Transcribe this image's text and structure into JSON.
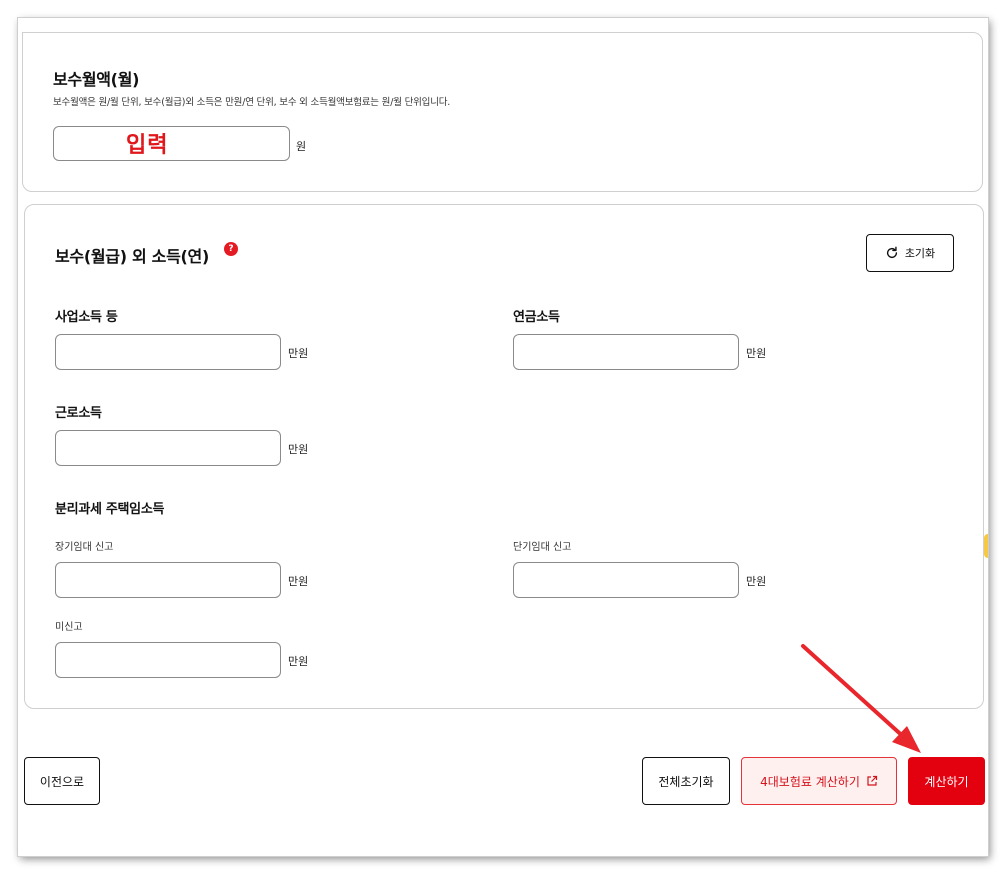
{
  "salary_section": {
    "title": "보수월액(월)",
    "description": "보수월액은 원/월 단위, 보수(월급)외 소득은 만원/연 단위, 보수 외 소득월액보험료는 원/월 단위입니다.",
    "input_value": "",
    "overlay_text": "입력",
    "unit": "원"
  },
  "other_income_section": {
    "title": "보수(월급) 외 소득(연)",
    "help_badge": "?",
    "reset_label": "초기화",
    "fields": {
      "business": {
        "label": "사업소득 등",
        "value": "",
        "unit": "만원"
      },
      "pension": {
        "label": "연금소득",
        "value": "",
        "unit": "만원"
      },
      "earned": {
        "label": "근로소득",
        "value": "",
        "unit": "만원"
      }
    },
    "rental": {
      "label": "분리과세 주택임소득",
      "long_term": {
        "label": "장기임대 신고",
        "value": "",
        "unit": "만원"
      },
      "short_term": {
        "label": "단기임대 신고",
        "value": "",
        "unit": "만원"
      },
      "unreported": {
        "label": "미신고",
        "value": "",
        "unit": "만원"
      }
    }
  },
  "footer": {
    "prev_label": "이전으로",
    "reset_all_label": "전체초기화",
    "four_insurance_label": "4대보험료 계산하기",
    "calculate_label": "계산하기"
  },
  "colors": {
    "accent_red": "#e3000f",
    "annotation_red": "#e0171b",
    "border": "#cfcfcf"
  },
  "icons": {
    "reset": "refresh-icon",
    "external": "external-link-icon",
    "help": "help-icon",
    "annotation": "red-arrow-annotation"
  }
}
